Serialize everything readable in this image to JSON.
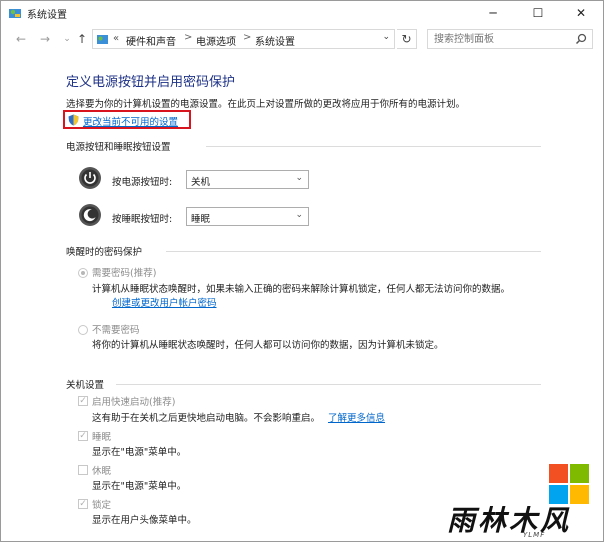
{
  "window": {
    "title": "系统设置"
  },
  "address_bar": {
    "overflow": "«",
    "crumbs": [
      "硬件和声音",
      "电源选项",
      "系统设置"
    ],
    "separator": ">",
    "search_placeholder": "搜索控制面板"
  },
  "page": {
    "title": "定义电源按钮并启用密码保护",
    "description": "选择要为你的计算机设置的电源设置。在此页上对设置所做的更改将应用于你所有的电源计划。",
    "admin_link": "更改当前不可用的设置"
  },
  "power_buttons": {
    "header": "电源按钮和睡眠按钮设置",
    "rows": [
      {
        "label": "按电源按钮时:",
        "value": "关机"
      },
      {
        "label": "按睡眠按钮时:",
        "value": "睡眠"
      }
    ]
  },
  "wake_password": {
    "header": "唤醒时的密码保护",
    "options": [
      {
        "label": "需要密码(推荐)",
        "selected": true,
        "desc_line1": "计算机从睡眠状态唤醒时，如果未输入正确的密码来解除计算机锁定，任何人都无法访问你的数据。",
        "link": "创建或更改用户帐户密码"
      },
      {
        "label": "不需要密码",
        "selected": false,
        "desc_line1": "将你的计算机从睡眠状态唤醒时，任何人都可以访问你的数据，因为计算机未锁定。"
      }
    ]
  },
  "shutdown": {
    "header": "关机设置",
    "items": [
      {
        "label": "启用快速启动(推荐)",
        "checked": true,
        "desc": "这有助于在关机之后更快地启动电脑。不会影响重启。",
        "link": "了解更多信息"
      },
      {
        "label": "睡眠",
        "checked": true,
        "desc": "显示在\"电源\"菜单中。"
      },
      {
        "label": "休眠",
        "checked": false,
        "desc": "显示在\"电源\"菜单中。"
      },
      {
        "label": "锁定",
        "checked": true,
        "desc": "显示在用户头像菜单中。"
      }
    ]
  },
  "watermark": {
    "text": "雨林木风",
    "sub": "YLMF"
  },
  "colors": {
    "title": "#1e3287",
    "link": "#0066cc",
    "highlight_box": "#d8151e"
  }
}
